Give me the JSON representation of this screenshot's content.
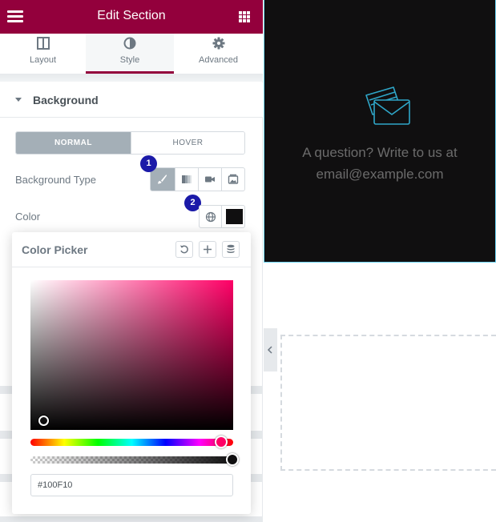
{
  "header": {
    "title": "Edit Section"
  },
  "tabs": [
    {
      "label": "Layout"
    },
    {
      "label": "Style"
    },
    {
      "label": "Advanced"
    }
  ],
  "active_tab": "Style",
  "section": {
    "title": "Background"
  },
  "state_switch": {
    "normal": "NORMAL",
    "hover": "HOVER",
    "active": "NORMAL"
  },
  "controls": {
    "background_type_label": "Background Type",
    "color_label": "Color"
  },
  "badges": {
    "first": "1",
    "second": "2"
  },
  "color_picker": {
    "title": "Color Picker",
    "hex_value": "#100F10"
  },
  "preview": {
    "line1": "A question? Write to us at",
    "line2": "email@example.com"
  },
  "colors": {
    "brand": "#93003c",
    "selected_color": "#100F10",
    "badge": "#1b1aa8",
    "section_outline": "#71d7f7"
  }
}
